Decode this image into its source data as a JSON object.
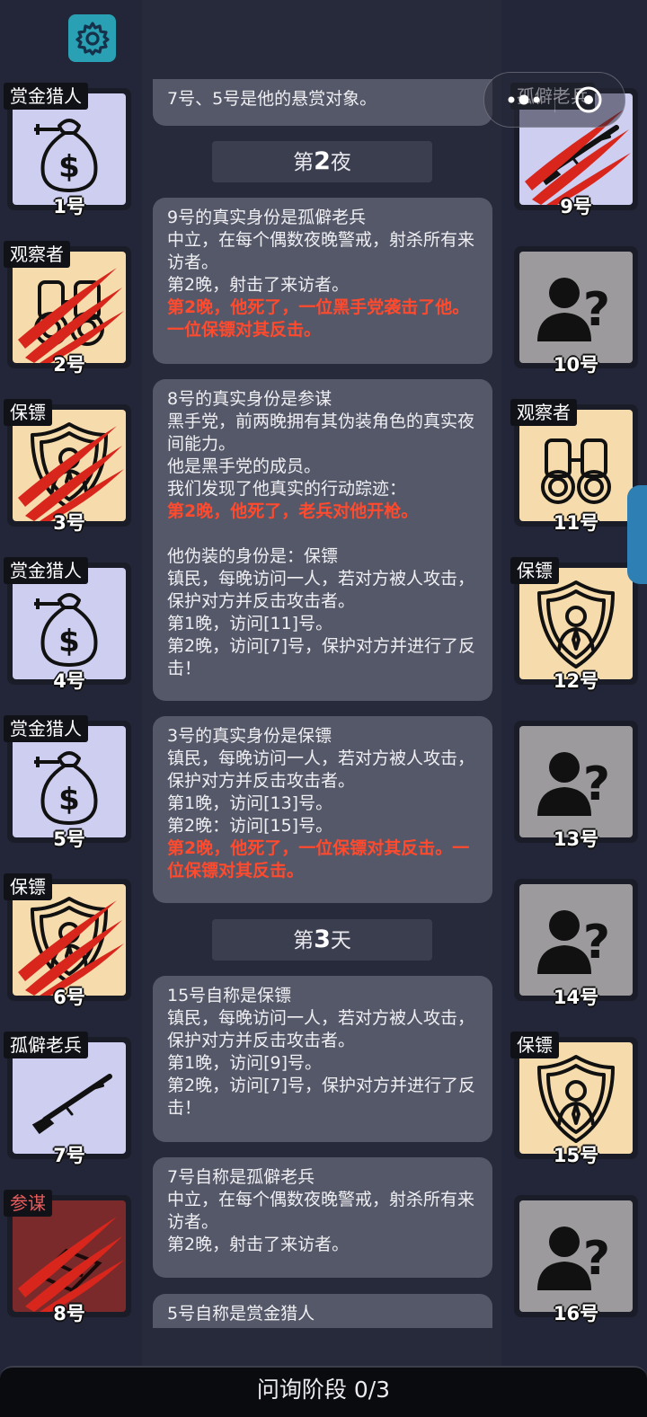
{
  "bottom": {
    "status": "问询阶段 0/3"
  },
  "top_bubble": {
    "text": "7号、5号是他的悬赏对象。"
  },
  "phases": [
    {
      "prefix": "第",
      "num": "2",
      "suffix": "夜"
    },
    {
      "prefix": "第",
      "num": "3",
      "suffix": "天"
    }
  ],
  "messages": [
    {
      "lines": [
        "9号的真实身份是孤僻老兵",
        "中立，在每个偶数夜晚警戒，射杀所有来访者。",
        "第2晚，射击了来访者。"
      ],
      "red": "第2晚，他死了，一位黑手党袭击了他。一位保镖对其反击。"
    },
    {
      "lines": [
        "8号的真实身份是参谋",
        "黑手党，前两晚拥有其伪装角色的真实夜间能力。",
        "他是黑手党的成员。",
        "我们发现了他真实的行动踪迹："
      ],
      "red": "第2晚，他死了，老兵对他开枪。",
      "lines2": [
        "",
        "他伪装的身份是：保镖",
        "镇民，每晚访问一人，若对方被人攻击，保护对方并反击攻击者。",
        "第1晚，访问[11]号。",
        "第2晚，访问[7]号，保护对方并进行了反击！"
      ]
    },
    {
      "lines": [
        "3号的真实身份是保镖",
        "镇民，每晚访问一人，若对方被人攻击，保护对方并反击攻击者。",
        "第1晚，访问[13]号。",
        "第2晚：访问[15]号。"
      ],
      "red": "第2晚，他死了，一位保镖对其反击。一位保镖对其反击。"
    },
    {
      "lines": [
        "15号自称是保镖",
        "镇民，每晚访问一人，若对方被人攻击，保护对方并反击攻击者。",
        "第1晚，访问[9]号。",
        "第2晚，访问[7]号，保护对方并进行了反击！"
      ]
    },
    {
      "lines": [
        "7号自称是孤僻老兵",
        "中立，在每个偶数夜晚警戒，射杀所有来访者。",
        "第2晚，射击了来访者。"
      ]
    },
    {
      "lines": [
        "5号自称是赏金猎人"
      ]
    }
  ],
  "players_left": [
    {
      "number": "1号",
      "role": "赏金猎人",
      "bg": "lavender",
      "icon": "money-bag-icon",
      "dead": false
    },
    {
      "number": "2号",
      "role": "观察者",
      "bg": "peach",
      "icon": "binoculars-icon",
      "dead": true
    },
    {
      "number": "3号",
      "role": "保镖",
      "bg": "peach",
      "icon": "bodyguard-shield-icon",
      "dead": true
    },
    {
      "number": "4号",
      "role": "赏金猎人",
      "bg": "lavender",
      "icon": "money-bag-icon",
      "dead": false
    },
    {
      "number": "5号",
      "role": "赏金猎人",
      "bg": "lavender",
      "icon": "money-bag-icon",
      "dead": false
    },
    {
      "number": "6号",
      "role": "保镖",
      "bg": "peach",
      "icon": "bodyguard-shield-icon",
      "dead": true
    },
    {
      "number": "7号",
      "role": "孤僻老兵",
      "bg": "lavender",
      "icon": "rifle-icon",
      "dead": false
    },
    {
      "number": "8号",
      "role": "参谋",
      "bg": "dark-red",
      "icon": "strategist-icon",
      "dead": true
    }
  ],
  "players_right": [
    {
      "number": "9号",
      "role": "孤僻老兵",
      "bg": "lavender",
      "icon": "rifle-icon",
      "dead": true
    },
    {
      "number": "10号",
      "role": "",
      "bg": "gray",
      "icon": "unknown-person-icon",
      "dead": false
    },
    {
      "number": "11号",
      "role": "观察者",
      "bg": "peach",
      "icon": "binoculars-icon",
      "dead": false
    },
    {
      "number": "12号",
      "role": "保镖",
      "bg": "peach",
      "icon": "bodyguard-shield-icon",
      "dead": false
    },
    {
      "number": "13号",
      "role": "",
      "bg": "gray",
      "icon": "unknown-person-icon",
      "dead": false
    },
    {
      "number": "14号",
      "role": "",
      "bg": "gray",
      "icon": "unknown-person-icon",
      "dead": false
    },
    {
      "number": "15号",
      "role": "保镖",
      "bg": "peach",
      "icon": "bodyguard-shield-icon",
      "dead": false
    },
    {
      "number": "16号",
      "role": "",
      "bg": "gray",
      "icon": "unknown-person-icon",
      "dead": false
    }
  ],
  "colors": {
    "background": "#232638",
    "bubble": "#555868",
    "death_text": "#ff4a2e",
    "settings": "#2aa0b4",
    "lavender": "#cecef0",
    "peach": "#f6dcac",
    "gray": "#9c9a9c",
    "dark_red": "#7a2a2a",
    "claw": "#d8261c"
  },
  "icons": [
    "gear-icon",
    "menu-dots-icon",
    "close-circle-icon"
  ]
}
